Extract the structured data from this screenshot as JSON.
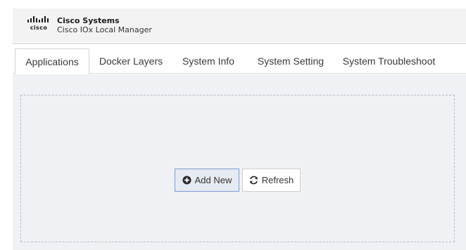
{
  "header": {
    "logo_text": "cisco",
    "company": "Cisco Systems",
    "product": "Cisco IOx Local Manager"
  },
  "tabs": [
    {
      "label": "Applications",
      "active": true
    },
    {
      "label": "Docker Layers",
      "active": false
    },
    {
      "label": "System Info",
      "active": false
    },
    {
      "label": "System Setting",
      "active": false
    },
    {
      "label": "System Troubleshoot",
      "active": false
    }
  ],
  "actions": {
    "add_new_label": "Add New",
    "add_new_icon": "plus-circle-icon",
    "refresh_label": "Refresh",
    "refresh_icon": "refresh-icon"
  },
  "colors": {
    "header_bg": "#f3f3f3",
    "content_bg": "#eff1f4",
    "add_button_border": "#7f9ed0"
  }
}
